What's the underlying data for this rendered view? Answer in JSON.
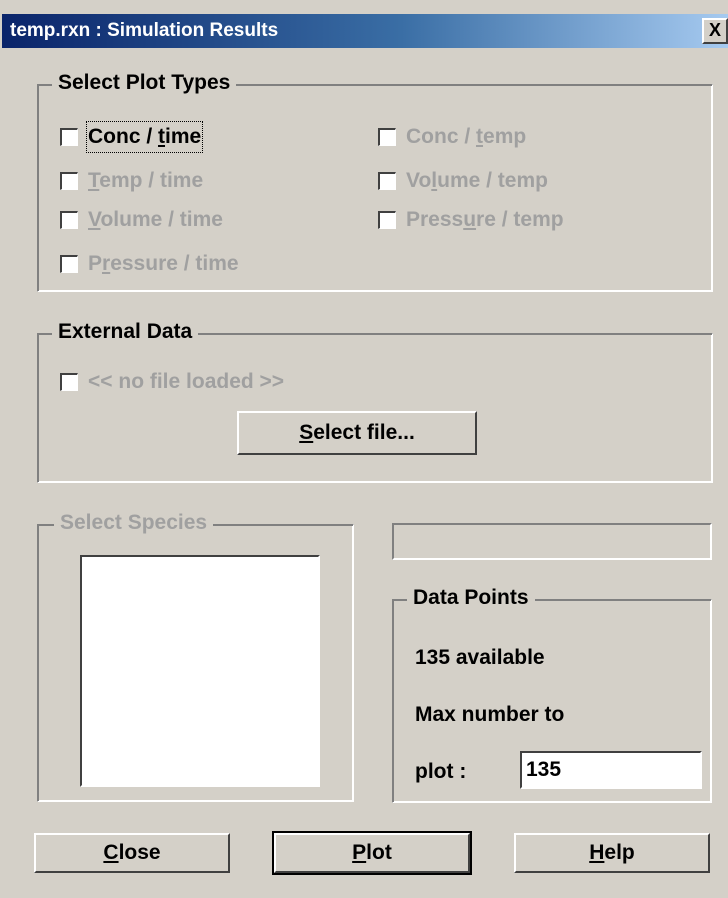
{
  "window": {
    "title": "temp.rxn : Simulation Results",
    "close_glyph": "X"
  },
  "plot_types": {
    "legend": "Select Plot Types",
    "options": [
      {
        "pre": "Conc / ",
        "key": "t",
        "post": "ime",
        "enabled": true,
        "checked": false
      },
      {
        "pre": "",
        "key": "T",
        "post": "emp / time",
        "enabled": false,
        "checked": false
      },
      {
        "pre": "",
        "key": "V",
        "post": "olume / time",
        "enabled": false,
        "checked": false
      },
      {
        "pre": "P",
        "key": "r",
        "post": "essure / time",
        "enabled": false,
        "checked": false
      },
      {
        "pre": "Conc / ",
        "key": "t",
        "post": "emp",
        "enabled": false,
        "checked": false
      },
      {
        "pre": "Vo",
        "key": "l",
        "post": "ume / temp",
        "enabled": false,
        "checked": false
      },
      {
        "pre": "Press",
        "key": "u",
        "post": "re / temp",
        "enabled": false,
        "checked": false
      }
    ]
  },
  "external_data": {
    "legend": "External Data",
    "no_file_label": "<< no file loaded >>",
    "select_file": {
      "pre": "",
      "key": "S",
      "post": "elect file..."
    }
  },
  "species": {
    "legend": "Select Species",
    "items": []
  },
  "data_points": {
    "legend": "Data Points",
    "available": "135 available",
    "max_label": "Max number to",
    "plot_label": "plot :",
    "max_value": "135"
  },
  "buttons": {
    "close": {
      "pre": "",
      "key": "C",
      "post": "lose"
    },
    "plot": {
      "pre": "",
      "key": "P",
      "post": "lot"
    },
    "help": {
      "pre": "",
      "key": "H",
      "post": "elp"
    }
  }
}
